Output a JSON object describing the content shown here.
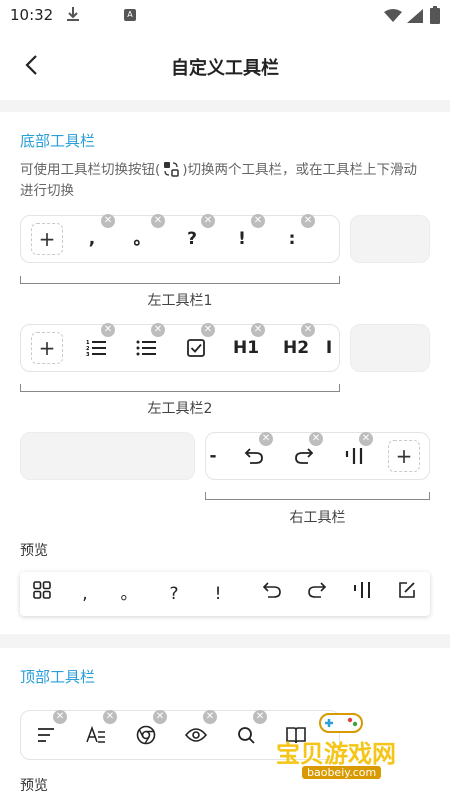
{
  "status": {
    "time": "10:32",
    "a_badge": "A"
  },
  "header": {
    "title": "自定义工具栏"
  },
  "bottom": {
    "title": "底部工具栏",
    "desc_before": "可使用工具栏切换按钮(",
    "desc_after": ")切换两个工具栏，或在工具栏上下滑动进行切换",
    "left1": {
      "plus": "+",
      "items": [
        ",",
        "。",
        "?",
        "!",
        ":"
      ],
      "label": "左工具栏1"
    },
    "left2": {
      "plus": "+",
      "items": [
        "ordered-list-icon",
        "bullet-list-icon",
        "checkbox-icon",
        "H1",
        "H2",
        "I"
      ],
      "label": "左工具栏2"
    },
    "right": {
      "plus": "+",
      "items": [
        "-",
        "undo-icon",
        "redo-icon",
        "divider-icon"
      ],
      "label": "右工具栏"
    },
    "preview_label": "预览",
    "preview": [
      "grid-icon",
      ",",
      "。",
      "?",
      "!",
      "undo-icon",
      "redo-icon",
      "divider-icon",
      "edit-icon"
    ]
  },
  "top": {
    "title": "顶部工具栏",
    "items": [
      "menu-icon",
      "text-style-icon",
      "chrome-icon",
      "eye-icon",
      "search-icon",
      "book-icon"
    ],
    "preview_label": "预览"
  },
  "watermark": {
    "text": "宝贝游戏网",
    "url": "baobeiy.com"
  },
  "colors": {
    "accent": "#2a9fd8",
    "delete_badge": "#bdbdbd",
    "watermark": "#f5c518"
  }
}
